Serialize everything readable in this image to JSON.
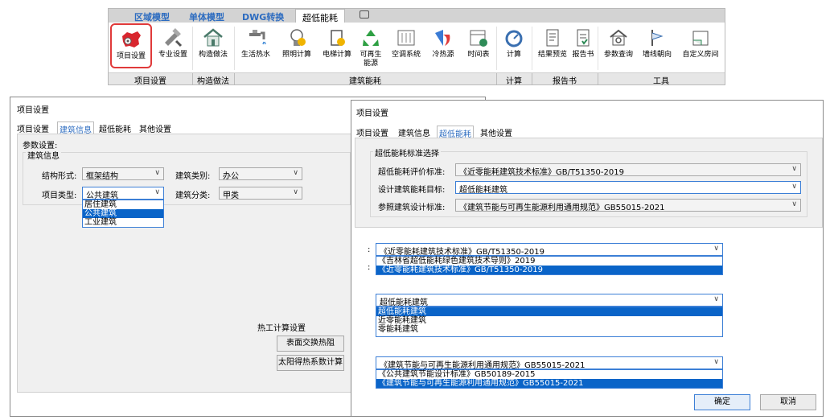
{
  "ribbon": {
    "tabs": [
      "区域模型",
      "单体模型",
      "DWG转换",
      "超低能耗"
    ],
    "buttons": [
      {
        "label": "项目设置",
        "icon": "china-map-gear-icon"
      },
      {
        "label": "专业设置",
        "icon": "tools-icon"
      },
      {
        "label": "构造做法",
        "icon": "house-construction-icon"
      },
      {
        "label": "生活热水",
        "icon": "faucet-icon"
      },
      {
        "label": "照明计算",
        "icon": "bulb-icon"
      },
      {
        "label": "电梯计算",
        "icon": "elevator-icon"
      },
      {
        "label": "可再生\n能源",
        "icon": "recycle-icon"
      },
      {
        "label": "空调系统",
        "icon": "ac-icon"
      },
      {
        "label": "冷热源",
        "icon": "cold-heat-icon"
      },
      {
        "label": "时间表",
        "icon": "schedule-icon"
      },
      {
        "label": "计算",
        "icon": "gauge-icon"
      },
      {
        "label": "结果预览",
        "icon": "result-doc-icon"
      },
      {
        "label": "报告书",
        "icon": "report-icon"
      },
      {
        "label": "参数查询",
        "icon": "param-search-icon"
      },
      {
        "label": "墙线朝向",
        "icon": "wall-orient-icon"
      },
      {
        "label": "自定义房间",
        "icon": "custom-room-icon"
      }
    ],
    "groups": [
      "项目设置",
      "构造做法",
      "建筑能耗",
      "计算",
      "报告书",
      "工具"
    ]
  },
  "left_dialog": {
    "title": "项目设置",
    "tabs": [
      "项目设置",
      "建筑信息",
      "超低能耗",
      "其他设置"
    ],
    "param_title": "参数设置:",
    "group_title": "建筑信息",
    "structure_label": "结构形式:",
    "structure_value": "框架结构",
    "building_type_label": "建筑类别:",
    "building_type_value": "办公",
    "project_type_label": "项目类型:",
    "project_type_value": "公共建筑",
    "classify_label": "建筑分类:",
    "classify_value": "甲类",
    "project_type_options": [
      "居住建筑",
      "公共建筑",
      "工业建筑"
    ],
    "thermal_title": "热工计算设置",
    "surface_btn": "表面交换热阻",
    "solar_btn": "太阳得热系数计算"
  },
  "right_dialog": {
    "title": "项目设置",
    "tabs": [
      "项目设置",
      "建筑信息",
      "超低能耗",
      "其他设置"
    ],
    "group_title": "超低能耗标准选择",
    "eval_label": "超低能耗评价标准:",
    "eval_value": "《近零能耗建筑技术标准》GB/T51350-2019",
    "target_label": "设计建筑能耗目标:",
    "target_value": "超低能耗建筑",
    "ref_label": "参照建筑设计标准:",
    "ref_value": "《建筑节能与可再生能源利用通用规范》GB55015-2021",
    "colon": ":",
    "eval_dd_value": "《近零能耗建筑技术标准》GB/T51350-2019",
    "eval_options": [
      "《吉林省超低能耗绿色建筑技术导则》2019",
      "《近零能耗建筑技术标准》GB/T51350-2019"
    ],
    "target_dd_value": "超低能耗建筑",
    "target_options": [
      "超低能耗建筑",
      "近零能耗建筑",
      "零能耗建筑"
    ],
    "ref_dd_value": "《建筑节能与可再生能源利用通用规范》GB55015-2021",
    "ref_options": [
      "《公共建筑节能设计标准》GB50189-2015",
      "《建筑节能与可再生能源利用通用规范》GB55015-2021"
    ],
    "ok": "确定",
    "cancel": "取消"
  },
  "colors": {
    "accent": "#2d6cc0",
    "selection": "#0a64c8",
    "highlight_border": "#e03a3a"
  }
}
